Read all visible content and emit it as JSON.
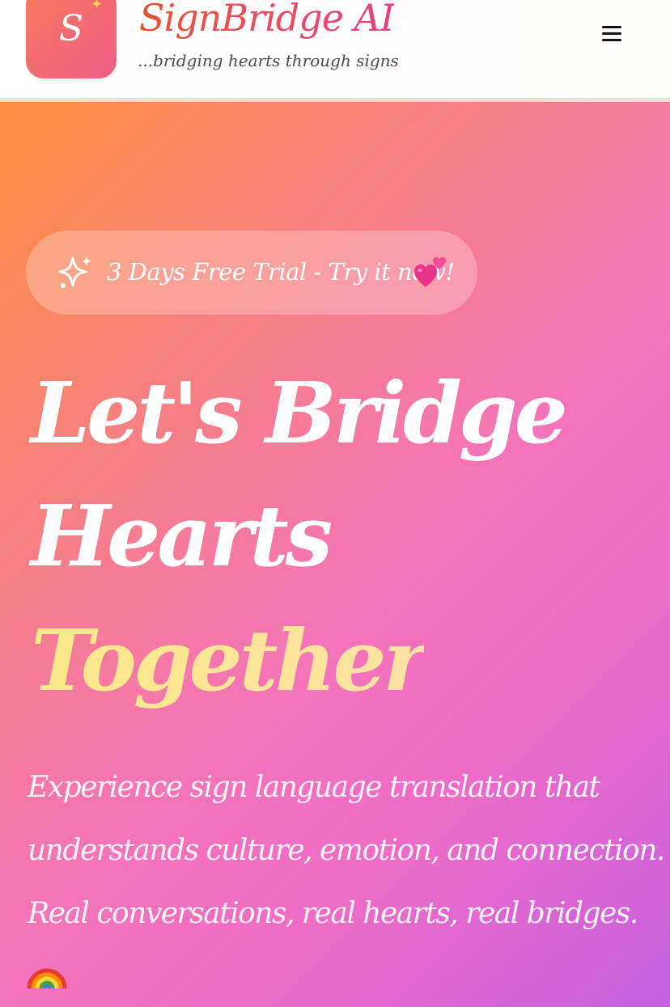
{
  "header": {
    "logo_letter": "S",
    "brand_name": "SignBridge AI",
    "tagline": "...bridging hearts through signs",
    "menu_icon": "hamburger-menu-icon"
  },
  "hero": {
    "trial_badge": {
      "icon": "sparkle-icon",
      "text": "3 Days Free Trial - Try it now!",
      "emoji": "two-hearts-emoji"
    },
    "headline": {
      "line1": "Let's Bridge",
      "line2": "Hearts",
      "line3": "Together"
    },
    "subtext": {
      "line1": "Experience sign language translation that",
      "line2": "understands culture, emotion, and connection.",
      "line3": "Real conversations, real hearts, real bridges."
    },
    "rainbow_icon": "rainbow-emoji"
  },
  "colors": {
    "brand_orange": "#e8542f",
    "brand_pink": "#e4407f",
    "hero_start": "#fb8e3c",
    "hero_mid": "#f474ba",
    "hero_end": "#c55fe0",
    "headline_accent": "#fbe98a"
  }
}
